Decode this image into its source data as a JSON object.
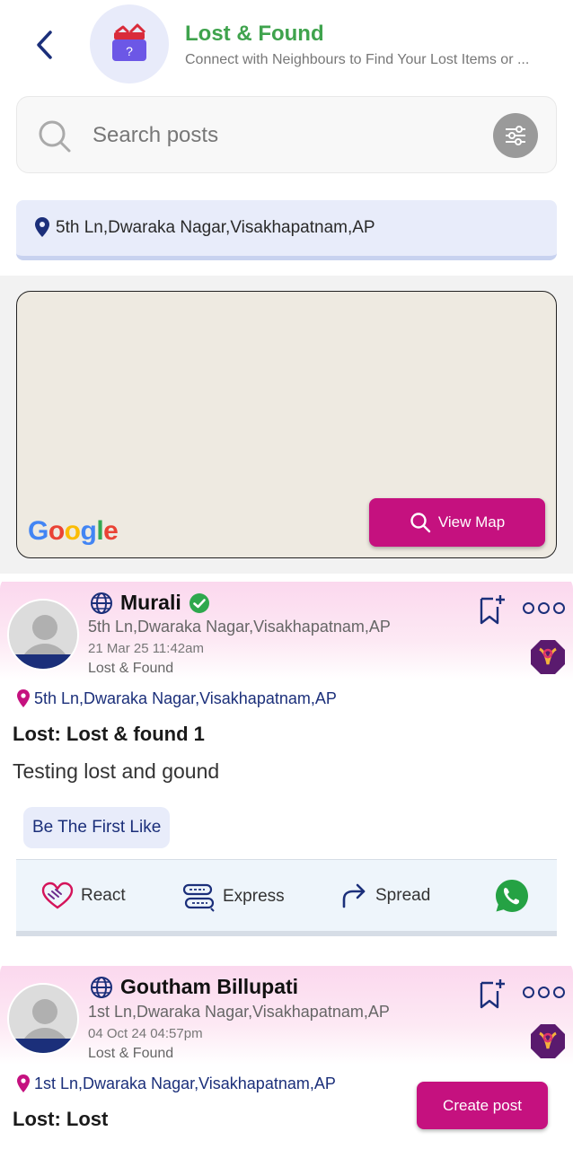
{
  "header": {
    "title": "Lost & Found",
    "subtitle": "Connect with Neighbours to Find Your Lost Items or ..."
  },
  "search": {
    "placeholder": "Search posts"
  },
  "location": {
    "text": "5th Ln,Dwaraka Nagar,Visakhapatnam,AP"
  },
  "map": {
    "provider_logo": "Google",
    "view_map_label": "View Map"
  },
  "posts": [
    {
      "user_name": "Murali",
      "verified": true,
      "user_location": "5th Ln,Dwaraka Nagar,Visakhapatnam,AP",
      "date": "21 Mar 25 11:42am",
      "category": "Lost & Found",
      "location": "5th Ln,Dwaraka Nagar,Visakhapatnam,AP",
      "title": "Lost: Lost & found 1",
      "description": "Testing lost and gound",
      "like_label": "Be The First Like",
      "actions": {
        "react": "React",
        "express": "Express",
        "spread": "Spread"
      }
    },
    {
      "user_name": "Goutham Billupati",
      "verified": false,
      "user_location": "1st Ln,Dwaraka Nagar,Visakhapatnam,AP",
      "date": "04 Oct 24 04:57pm",
      "category": "Lost & Found",
      "location": "1st Ln,Dwaraka Nagar,Visakhapatnam,AP",
      "title": "Lost: Lost"
    }
  ],
  "create_post_label": "Create post",
  "colors": {
    "accent_magenta": "#c5117f",
    "title_green": "#3fa34d",
    "navy": "#1b2f7a",
    "whatsapp_green": "#25a244"
  }
}
